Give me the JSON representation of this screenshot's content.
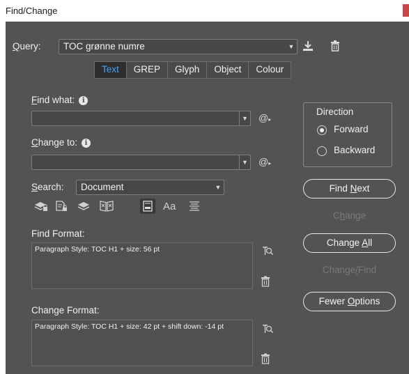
{
  "window": {
    "title": "Find/Change"
  },
  "query": {
    "label_prefix": "",
    "label_underlined": "Q",
    "label_rest": "uery:",
    "value": "TOC grønne numre"
  },
  "tabs": [
    {
      "label": "Text",
      "active": true
    },
    {
      "label": "GREP",
      "active": false
    },
    {
      "label": "Glyph",
      "active": false
    },
    {
      "label": "Object",
      "active": false
    },
    {
      "label": "Colour",
      "active": false
    }
  ],
  "find_what": {
    "label_u": "F",
    "label_rest": "ind what:",
    "value": ""
  },
  "change_to": {
    "label_u": "C",
    "label_rest": "hange to:",
    "value": ""
  },
  "search": {
    "label_u": "S",
    "label_rest": "earch:",
    "value": "Document"
  },
  "direction": {
    "title": "Direction",
    "options": [
      {
        "label": "Forward",
        "selected": true
      },
      {
        "label": "Backward",
        "selected": false
      }
    ]
  },
  "buttons": {
    "find_next_pre": "Find ",
    "find_next_u": "N",
    "find_next_post": "ext",
    "change_pre": "C",
    "change_u": "h",
    "change_post": "ange",
    "change_all_pre": "Change ",
    "change_all_u": "A",
    "change_all_post": "ll",
    "change_find_pre": "Change",
    "change_find_u": "/",
    "change_find_post": "Find",
    "fewer_options_pre": "Fewer ",
    "fewer_options_u": "O",
    "fewer_options_post": "ptions"
  },
  "find_format": {
    "label": "Find Format:",
    "text": "Paragraph Style: TOC H1 + size: 56 pt"
  },
  "change_format": {
    "label": "Change Format:",
    "text": "Paragraph Style: TOC H1 + size: 42 pt + shift down: -14 pt"
  },
  "option_icons": [
    "include-locked-layers-icon",
    "include-locked-stories-icon",
    "include-hidden-layers-icon",
    "include-master-pages-icon",
    "include-footnotes-icon",
    "case-sensitive-icon",
    "whole-word-icon"
  ],
  "glyphs": {
    "case_label": "Aa"
  }
}
